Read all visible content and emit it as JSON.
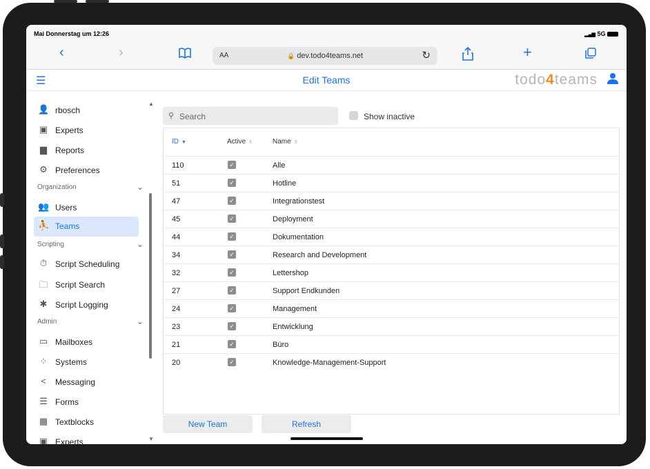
{
  "status": {
    "time": "Mai Donnerstag um 12:26",
    "network": "5G"
  },
  "browser": {
    "back_icon": "‹",
    "forward_icon": "›",
    "bookmarks_icon": "book-icon",
    "text_size": "AA",
    "url": "dev.todo4teams.net",
    "reload_icon": "reload-icon",
    "share_icon": "share-icon",
    "new_tab_icon": "+",
    "tabs_icon": "tabs-icon"
  },
  "header": {
    "title": "Edit Teams",
    "logo_prefix": "todo",
    "logo_four": "4",
    "logo_suffix": "teams"
  },
  "sidebar": {
    "items": [
      {
        "label": "rbosch",
        "icon": "user-icon"
      },
      {
        "label": "Experts",
        "icon": "badge-icon"
      },
      {
        "label": "Reports",
        "icon": "bar-chart-icon"
      },
      {
        "label": "Preferences",
        "icon": "gear-icon"
      },
      {
        "label": "Users",
        "icon": "users-icon"
      },
      {
        "label": "Teams",
        "icon": "teams-icon",
        "active": true
      },
      {
        "label": "Script Scheduling",
        "icon": "clock-icon"
      },
      {
        "label": "Script Search",
        "icon": "folder-search-icon"
      },
      {
        "label": "Script Logging",
        "icon": "bug-icon"
      },
      {
        "label": "Mailboxes",
        "icon": "inbox-icon"
      },
      {
        "label": "Systems",
        "icon": "network-icon"
      },
      {
        "label": "Messaging",
        "icon": "share-nodes-icon"
      },
      {
        "label": "Forms",
        "icon": "form-icon"
      },
      {
        "label": "Textblocks",
        "icon": "grid-icon"
      },
      {
        "label": "Experts",
        "icon": "badge-icon"
      }
    ],
    "groups": [
      {
        "label": "Organization"
      },
      {
        "label": "Scripting"
      },
      {
        "label": "Admin"
      }
    ]
  },
  "search": {
    "placeholder": "Search"
  },
  "filter": {
    "show_inactive_label": "Show inactive",
    "checked": false
  },
  "table": {
    "columns": [
      {
        "label": "ID",
        "sort": "desc"
      },
      {
        "label": "Active",
        "sort": "none"
      },
      {
        "label": "Name",
        "sort": "none"
      }
    ],
    "rows": [
      {
        "id": "110",
        "active": true,
        "name": "Alle"
      },
      {
        "id": "51",
        "active": true,
        "name": "Hotline"
      },
      {
        "id": "47",
        "active": true,
        "name": "Integrationstest"
      },
      {
        "id": "45",
        "active": true,
        "name": "Deployment"
      },
      {
        "id": "44",
        "active": true,
        "name": "Dokumentation"
      },
      {
        "id": "34",
        "active": true,
        "name": "Research and Development"
      },
      {
        "id": "32",
        "active": true,
        "name": "Lettershop"
      },
      {
        "id": "27",
        "active": true,
        "name": "Support Endkunden"
      },
      {
        "id": "24",
        "active": true,
        "name": "Management"
      },
      {
        "id": "23",
        "active": true,
        "name": "Entwicklung"
      },
      {
        "id": "21",
        "active": true,
        "name": "Büro"
      },
      {
        "id": "20",
        "active": true,
        "name": "Knowledge-Management-Support"
      }
    ]
  },
  "buttons": {
    "new_team": "New Team",
    "refresh": "Refresh"
  },
  "colors": {
    "accent": "#1a73e8",
    "logo_four": "#f28c1c",
    "active_bg": "#dbe8fb"
  }
}
